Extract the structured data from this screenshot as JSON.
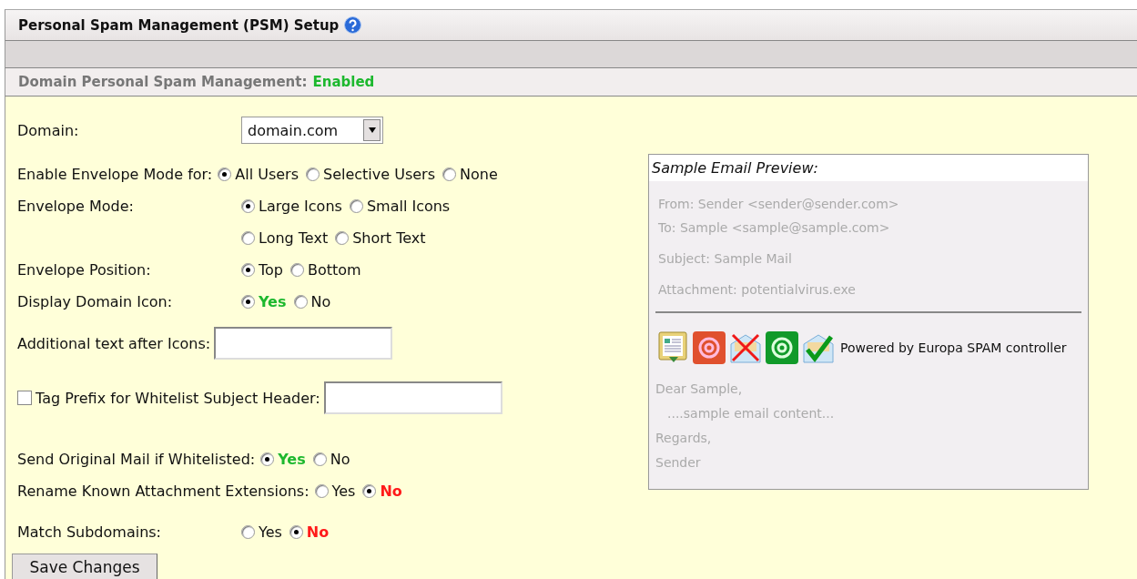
{
  "page_title": "Personal Spam Management (PSM) Setup",
  "section": {
    "label": "Domain Personal Spam Management:",
    "status": "Enabled"
  },
  "form": [
    {
      "kind": "select",
      "label": "Domain:",
      "value": "domain.com"
    },
    {
      "kind": "radio",
      "label": "Enable Envelope Mode for:",
      "inline": true,
      "lines": [
        [
          {
            "label": "All Users",
            "selected": true
          },
          {
            "label": "Selective Users",
            "selected": false
          },
          {
            "label": "None",
            "selected": false
          }
        ]
      ]
    },
    {
      "kind": "radio",
      "label": "Envelope Mode:",
      "inline": false,
      "lines": [
        [
          {
            "label": "Large Icons",
            "selected": true
          },
          {
            "label": "Small Icons",
            "selected": false
          }
        ],
        [
          {
            "label": "Long Text",
            "selected": false
          },
          {
            "label": "Short Text",
            "selected": false
          }
        ]
      ]
    },
    {
      "kind": "radio",
      "label": "Envelope Position:",
      "inline": false,
      "lines": [
        [
          {
            "label": "Top",
            "selected": true
          },
          {
            "label": "Bottom",
            "selected": false
          }
        ]
      ]
    },
    {
      "kind": "radio",
      "label": "Display Domain Icon:",
      "inline": false,
      "lines": [
        [
          {
            "label": "Yes",
            "selected": true,
            "color": "#1db82e"
          },
          {
            "label": "No",
            "selected": false
          }
        ]
      ]
    },
    {
      "kind": "text",
      "label": "Additional text after Icons:"
    },
    {
      "kind": "checkbox-text",
      "label": "Tag Prefix for Whitelist Subject Header:",
      "checked": false
    },
    {
      "kind": "radio",
      "label": "Send Original Mail if Whitelisted:",
      "inline": true,
      "lines": [
        [
          {
            "label": "Yes",
            "selected": true,
            "color": "#1db82e"
          },
          {
            "label": "No",
            "selected": false
          }
        ]
      ]
    },
    {
      "kind": "radio",
      "label": "Rename Known Attachment Extensions:",
      "inline": true,
      "lines": [
        [
          {
            "label": "Yes",
            "selected": false
          },
          {
            "label": "No",
            "selected": true,
            "color": "#ff1a1a"
          }
        ]
      ]
    },
    {
      "kind": "radio",
      "label": "Match Subdomains:",
      "inline": false,
      "lines": [
        [
          {
            "label": "Yes",
            "selected": false
          },
          {
            "label": "No",
            "selected": true,
            "color": "#ff1a1a"
          }
        ]
      ]
    }
  ],
  "save_button": "Save Changes",
  "preview": {
    "title": "Sample Email Preview:",
    "headers": [
      "From: Sender <sender@sender.com>",
      "To: Sample <sample@sample.com>",
      "Subject: Sample Mail",
      "Attachment: potentialvirus.exe"
    ],
    "powered_by": "Powered by Europa SPAM controller",
    "body": [
      "Dear Sample,",
      "....sample email content...",
      "Regards,",
      "Sender"
    ]
  }
}
